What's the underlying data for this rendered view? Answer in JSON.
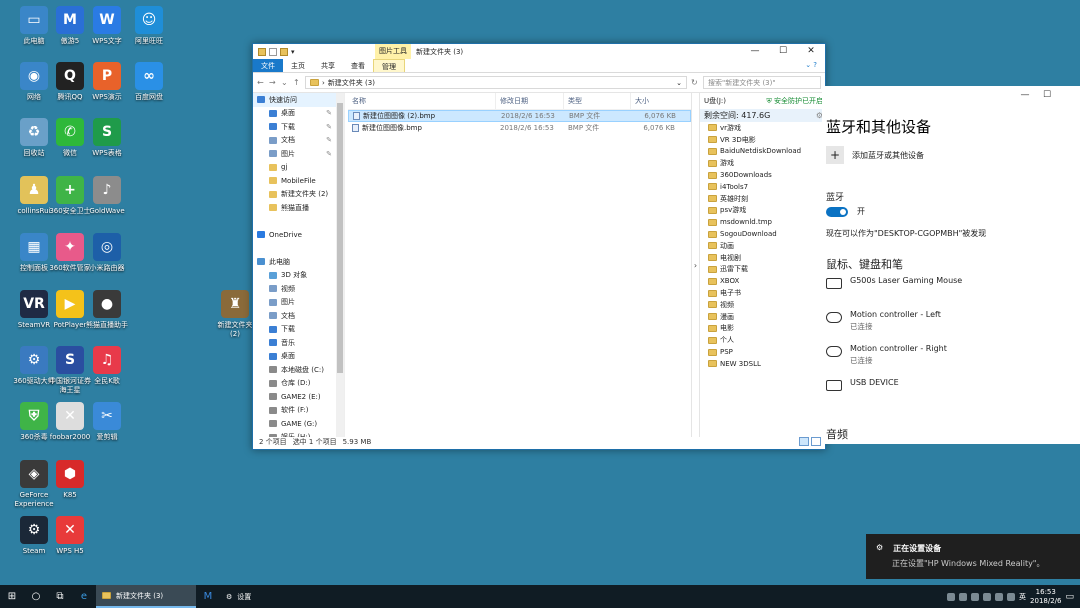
{
  "desktop_icons": [
    {
      "label": "此电脑",
      "color": "#3a86c8",
      "glyph": "▭"
    },
    {
      "label": "傲游5",
      "color": "#2a6fd6",
      "glyph": "M"
    },
    {
      "label": "WPS文字",
      "color": "#2a7be4",
      "glyph": "W"
    },
    {
      "label": "阿里旺旺",
      "color": "#1f8ed8",
      "glyph": "☺"
    },
    {
      "label": "网络",
      "color": "#3a86c8",
      "glyph": "◉"
    },
    {
      "label": "腾讯QQ",
      "color": "#222",
      "glyph": "Q"
    },
    {
      "label": "WPS演示",
      "color": "#e8622a",
      "glyph": "P"
    },
    {
      "label": "百度网盘",
      "color": "#2a90e6",
      "glyph": "∞"
    },
    {
      "label": "回收站",
      "color": "#6aa0c8",
      "glyph": "♻"
    },
    {
      "label": "微信",
      "color": "#2eb83a",
      "glyph": "✆"
    },
    {
      "label": "WPS表格",
      "color": "#1f9b4a",
      "glyph": "S"
    },
    {
      "label": "collinsRui",
      "color": "#e2c25a",
      "glyph": "♟"
    },
    {
      "label": "360安全卫士",
      "color": "#3fb447",
      "glyph": "+"
    },
    {
      "label": "GoldWave",
      "color": "#8c8c8c",
      "glyph": "♪"
    },
    {
      "label": "控制面板",
      "color": "#3a86c8",
      "glyph": "▦"
    },
    {
      "label": "360软件管家",
      "color": "#e85a8a",
      "glyph": "✦"
    },
    {
      "label": "小米路由器",
      "color": "#1d5fa8",
      "glyph": "◎"
    },
    {
      "label": "SteamVR",
      "color": "#1f2a44",
      "glyph": "VR"
    },
    {
      "label": "PotPlayer",
      "color": "#f4c21a",
      "glyph": "▶"
    },
    {
      "label": "熊猫直播助手",
      "color": "#3a3a3a",
      "glyph": "●"
    },
    {
      "label": "新建文件夹\n(2)",
      "color": "#8a6a3a",
      "glyph": "♜"
    },
    {
      "label": "360驱动大师",
      "color": "#3a7ac0",
      "glyph": "⚙"
    },
    {
      "label": "中国银河证券\n海王星",
      "color": "#2a4ea0",
      "glyph": "S"
    },
    {
      "label": "全民K歌",
      "color": "#e83a4a",
      "glyph": "♫"
    },
    {
      "label": "360杀毒",
      "color": "#3fb447",
      "glyph": "⛨"
    },
    {
      "label": "foobar2000",
      "color": "#dddddd",
      "glyph": "✕"
    },
    {
      "label": "爱剪辑",
      "color": "#3a8ad8",
      "glyph": "✂"
    },
    {
      "label": "GeForce\nExperience",
      "color": "#3a3a3a",
      "glyph": "◈"
    },
    {
      "label": "K85",
      "color": "#d82a2a",
      "glyph": "⬢"
    },
    {
      "label": "Steam",
      "color": "#1b2838",
      "glyph": "⚙"
    },
    {
      "label": "WPS H5",
      "color": "#e83a3a",
      "glyph": "✕"
    }
  ],
  "explorer": {
    "title": "新建文件夹 (3)",
    "context_tab": "图片工具",
    "ribbon": [
      "文件",
      "主页",
      "共享",
      "查看",
      "管理"
    ],
    "path": "新建文件夹 (3)",
    "search_placeholder": "搜索\"新建文件夹 (3)\"",
    "nav": [
      {
        "label": "快速访问",
        "color": "#3b7fd4",
        "indent": 0,
        "pin": false,
        "sel": true
      },
      {
        "label": "桌面",
        "color": "#3b7fd4",
        "indent": 1,
        "pin": true
      },
      {
        "label": "下载",
        "color": "#3b7fd4",
        "indent": 1,
        "pin": true
      },
      {
        "label": "文档",
        "color": "#7a9dc8",
        "indent": 1,
        "pin": true
      },
      {
        "label": "图片",
        "color": "#7a9dc8",
        "indent": 1,
        "pin": true
      },
      {
        "label": "gj",
        "color": "#e8c25c",
        "indent": 1,
        "pin": false
      },
      {
        "label": "MobileFile",
        "color": "#e8c25c",
        "indent": 1,
        "pin": false
      },
      {
        "label": "新建文件夹 (2)",
        "color": "#e8c25c",
        "indent": 1,
        "pin": false
      },
      {
        "label": "熊猫直播",
        "color": "#e8c25c",
        "indent": 1,
        "pin": false
      },
      {
        "label": "",
        "color": "",
        "indent": 0,
        "pin": false
      },
      {
        "label": "OneDrive",
        "color": "#2a7ae0",
        "indent": 0,
        "pin": false
      },
      {
        "label": "",
        "color": "",
        "indent": 0,
        "pin": false
      },
      {
        "label": "此电脑",
        "color": "#4a90d0",
        "indent": 0,
        "pin": false
      },
      {
        "label": "3D 对象",
        "color": "#5aa0d8",
        "indent": 1,
        "pin": false
      },
      {
        "label": "视频",
        "color": "#7a9dc8",
        "indent": 1,
        "pin": false
      },
      {
        "label": "图片",
        "color": "#7a9dc8",
        "indent": 1,
        "pin": false
      },
      {
        "label": "文档",
        "color": "#7a9dc8",
        "indent": 1,
        "pin": false
      },
      {
        "label": "下载",
        "color": "#3b7fd4",
        "indent": 1,
        "pin": false
      },
      {
        "label": "音乐",
        "color": "#3b7fd4",
        "indent": 1,
        "pin": false
      },
      {
        "label": "桌面",
        "color": "#3b7fd4",
        "indent": 1,
        "pin": false
      },
      {
        "label": "本地磁盘 (C:)",
        "color": "#8a8a8a",
        "indent": 1,
        "pin": false
      },
      {
        "label": "仓库 (D:)",
        "color": "#8a8a8a",
        "indent": 1,
        "pin": false
      },
      {
        "label": "GAME2 (E:)",
        "color": "#8a8a8a",
        "indent": 1,
        "pin": false
      },
      {
        "label": "软件 (F:)",
        "color": "#8a8a8a",
        "indent": 1,
        "pin": false
      },
      {
        "label": "GAME (G:)",
        "color": "#8a8a8a",
        "indent": 1,
        "pin": false
      },
      {
        "label": "娱乐 (H:)",
        "color": "#8a8a8a",
        "indent": 1,
        "pin": false
      }
    ],
    "columns": [
      "名称",
      "修改日期",
      "类型",
      "大小"
    ],
    "files": [
      {
        "name": "新建位图图像 (2).bmp",
        "date": "2018/2/6 16:53",
        "type": "BMP 文件",
        "size": "6,076 KB",
        "sel": true
      },
      {
        "name": "新建位图图像.bmp",
        "date": "2018/2/6 16:53",
        "type": "BMP 文件",
        "size": "6,076 KB",
        "sel": false
      }
    ],
    "usb": {
      "drive": "U盘(J:)",
      "safe": "安全防护已开启",
      "free": "剩余空间: 417.6G",
      "folders": [
        "vr游戏",
        "VR 3D电影",
        "BaiduNetdiskDownload",
        "游戏",
        "360Downloads",
        "i4Tools7",
        "英雄时刻",
        "psv游戏",
        "msdownld.tmp",
        "SogouDownload",
        "动画",
        "电视剧",
        "迅雷下载",
        "XBOX",
        "电子书",
        "视频",
        "漫画",
        "电影",
        "个人",
        "PSP",
        "NEW 3DSLL"
      ]
    },
    "status": {
      "count": "2 个项目",
      "selected": "选中 1 个项目",
      "size": "5.93 MB"
    }
  },
  "settings": {
    "title": "蓝牙和其他设备",
    "add_label": "添加蓝牙或其他设备",
    "bluetooth_heading": "蓝牙",
    "toggle_label": "开",
    "discoverable": "现在可以作为\"DESKTOP-CGOPMBH\"被发现",
    "mouse_heading": "鼠标、键盘和笔",
    "devices": [
      {
        "name": "G500s Laser Gaming Mouse",
        "sub": ""
      },
      {
        "name": "Motion controller - Left",
        "sub": "已连接"
      },
      {
        "name": "Motion controller - Right",
        "sub": "已连接"
      },
      {
        "name": "USB DEVICE",
        "sub": ""
      }
    ],
    "audio_heading": "音频"
  },
  "toast": {
    "title": "正在设置设备",
    "body": "正在设置\"HP Windows Mixed Reality\"。"
  },
  "taskbar": {
    "tasks": [
      "新建文件夹 (3)",
      "设置"
    ],
    "ime": "英",
    "time": "16:53",
    "date": "2018/2/6"
  }
}
